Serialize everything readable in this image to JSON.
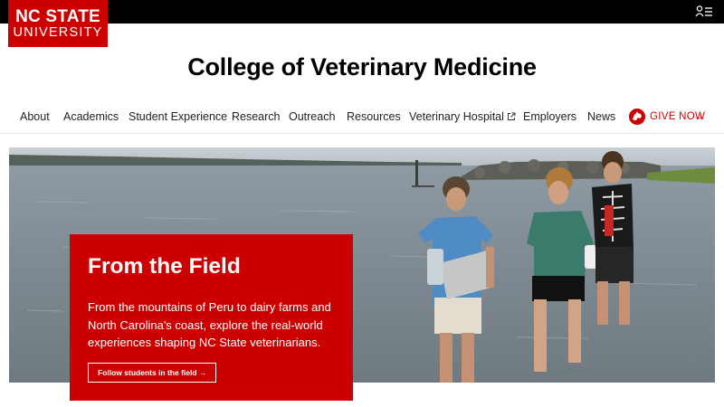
{
  "brand": {
    "line1": "NC STATE",
    "line2": "UNIVERSITY",
    "accent_color": "#cc0000",
    "menu_icon": "menu-list-icon"
  },
  "site": {
    "title": "College of Veterinary Medicine"
  },
  "nav": {
    "items": [
      {
        "label": "About"
      },
      {
        "label": "Academics"
      },
      {
        "label": "Student Experience"
      },
      {
        "label": "Research"
      },
      {
        "label": "Outreach"
      },
      {
        "label": "Resources"
      },
      {
        "label": "Veterinary Hospital",
        "icon": "external-link-icon"
      },
      {
        "label": "Employers"
      },
      {
        "label": "News"
      }
    ],
    "give": {
      "label": "GIVE NOW",
      "icon": "wolf-icon",
      "arrow": "→"
    }
  },
  "hero": {
    "image": "students-wading-in-water-photo",
    "heading": "From the Field",
    "body": "From the mountains of Peru to dairy farms and North Carolina's coast, explore the real-world experiences shaping NC State veterinarians.",
    "cta": "Follow students in the field →",
    "card_color": "#cc0000"
  }
}
